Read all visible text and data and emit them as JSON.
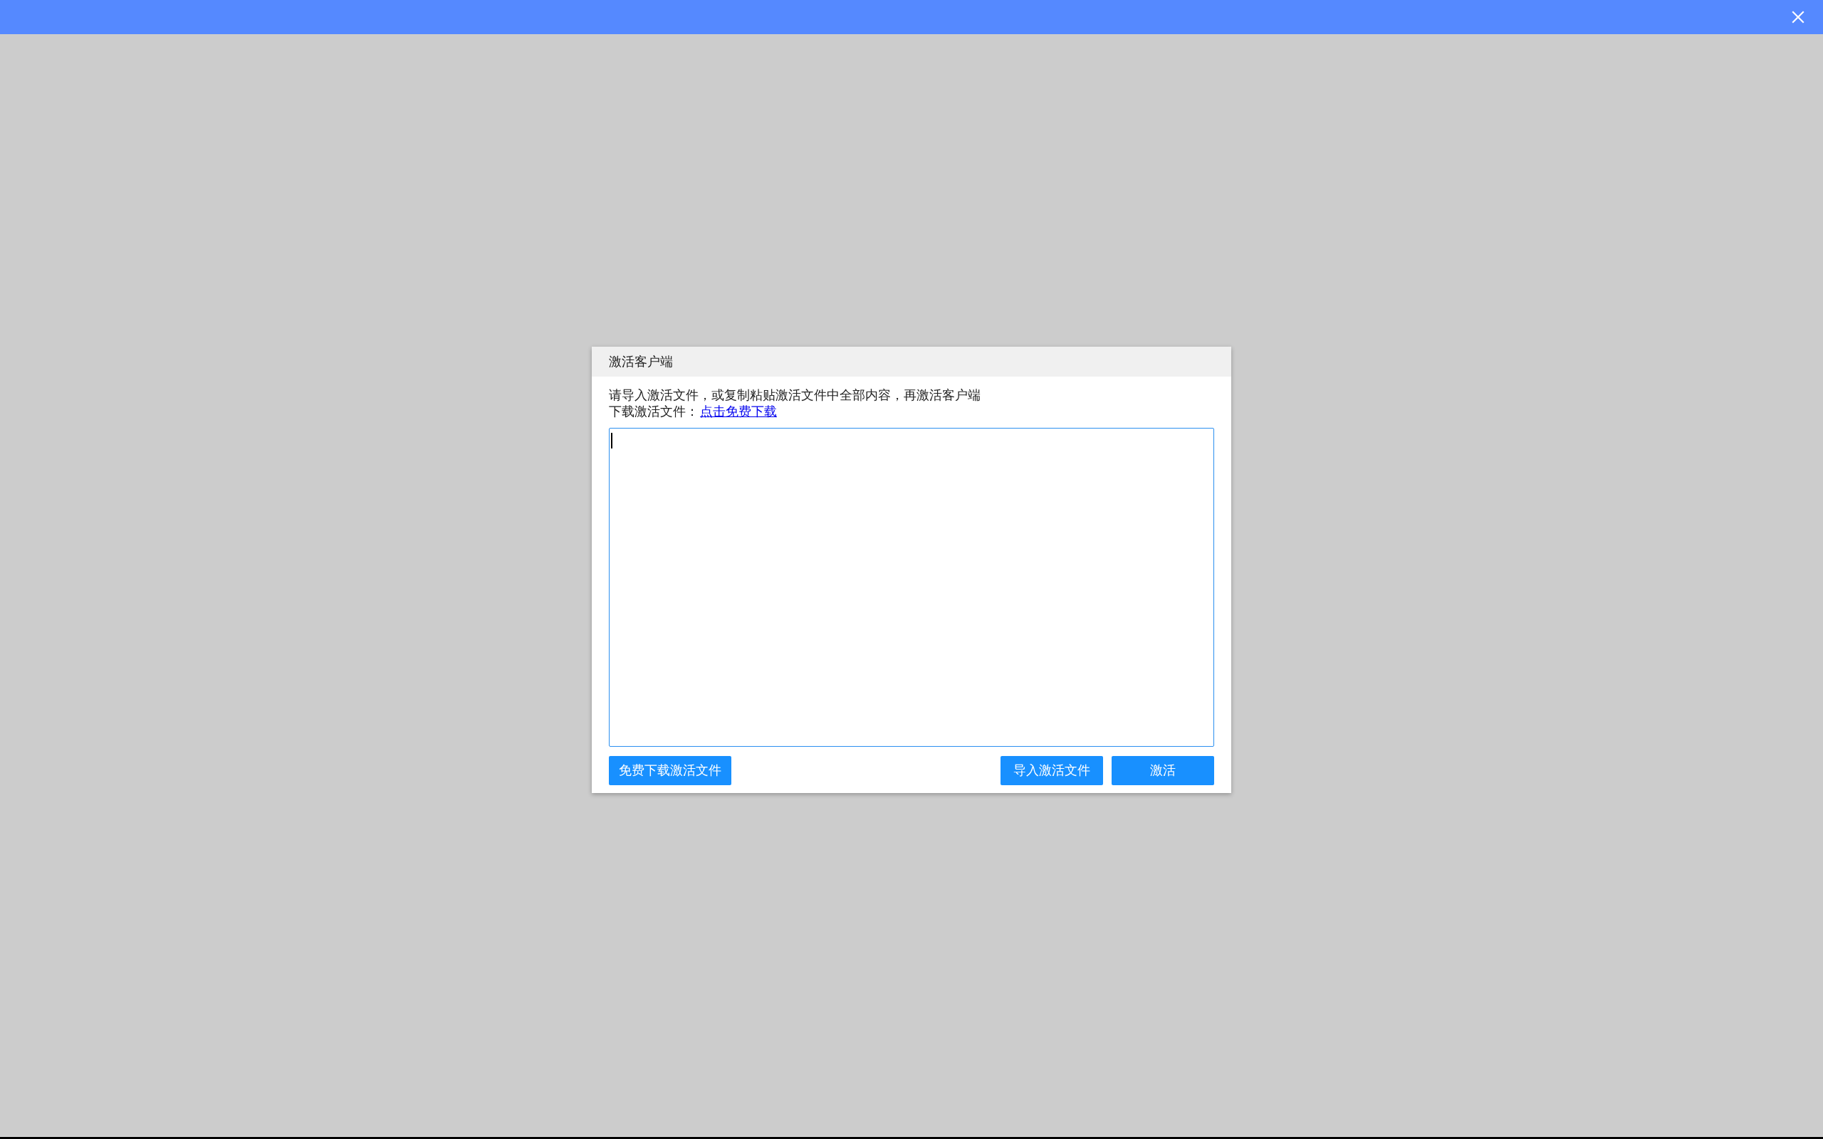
{
  "dialog": {
    "title": "激活客户端",
    "instruction": "请导入激活文件，或复制粘贴激活文件中全部内容，再激活客户端",
    "download_label": "下载激活文件：",
    "download_link": "点击免费下载",
    "text_area": {
      "focused": true
    },
    "footer": {
      "start": [
        {
          "label": "免费下载激活文件"
        }
      ],
      "end": [
        {
          "label": "导入激活文件"
        },
        {
          "label": "激活"
        }
      ]
    }
  }
}
